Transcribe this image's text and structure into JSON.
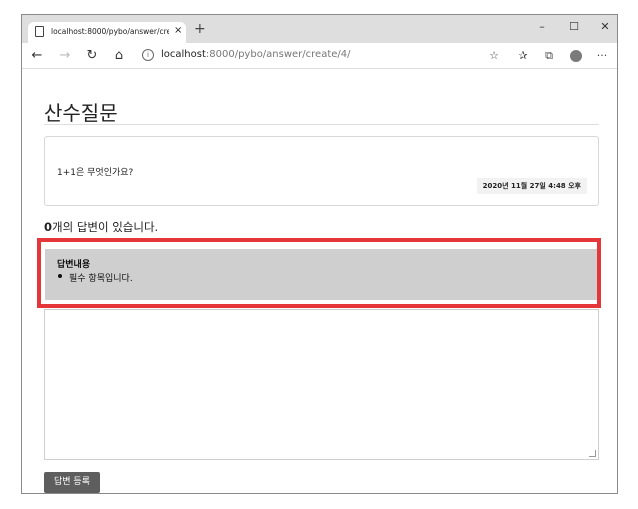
{
  "browser": {
    "tab_title": "localhost:8000/pybo/answer/crea",
    "tab_close": "×",
    "new_tab": "+",
    "window_buttons": {
      "minimize": "–",
      "maximize": "☐",
      "close": "✕"
    },
    "nav": {
      "back": "←",
      "forward": "→",
      "refresh": "↻",
      "home": "⌂"
    },
    "url_host": "localhost",
    "url_rest": ":8000/pybo/answer/create/4/",
    "right_icons": {
      "favorite": "☆",
      "favorites": "✰",
      "collections": "⧉",
      "more": "···"
    }
  },
  "question": {
    "subject": "산수질문",
    "content": "1+1은 무엇인가요?",
    "created_date": "2020년 11월 27일 4:48 오후"
  },
  "answers": {
    "count": "0",
    "count_suffix": "개의 답변이 있습니다."
  },
  "error_alert": {
    "field_label": "답변내용",
    "message": "필수 항목입니다."
  },
  "form": {
    "content_value": "",
    "submit_label": "답변 등록"
  },
  "colors": {
    "highlight": "#e5363a",
    "alert_bg": "#cfcfcf",
    "button_bg": "#5e5e5e"
  }
}
